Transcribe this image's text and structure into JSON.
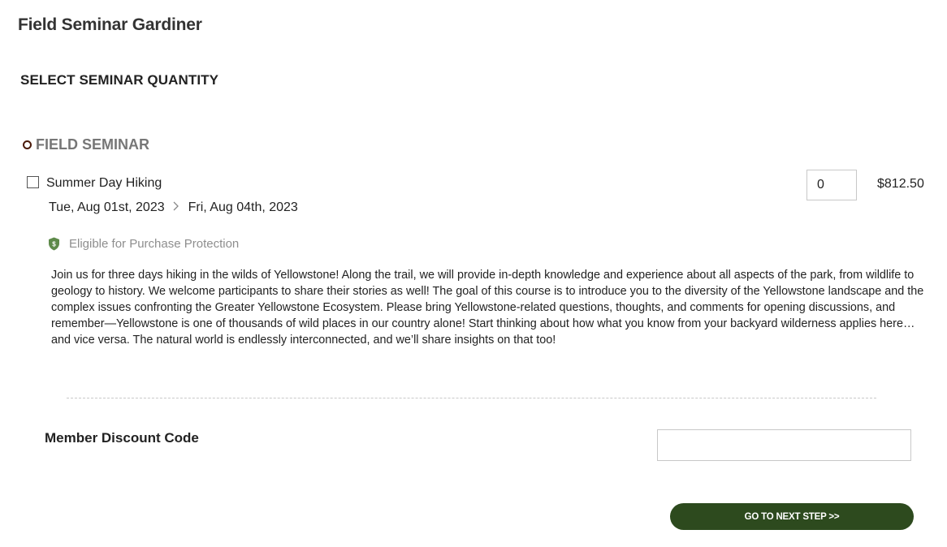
{
  "header": {
    "title": "Field Seminar Gardiner",
    "section_heading": "SELECT SEMINAR QUANTITY"
  },
  "category": {
    "label": "FIELD SEMINAR",
    "bullet_color": "#4a1a0a"
  },
  "item": {
    "name": "Summer Day Hiking",
    "checked": false,
    "start_date": "Tue, Aug 01st, 2023",
    "end_date": "Fri, Aug 04th, 2023",
    "quantity": "0",
    "price": "$812.50",
    "protection_label": "Eligible for Purchase Protection",
    "protection_icon": "shield-dollar-icon",
    "description": "Join us for three days hiking in the wilds of Yellowstone! Along the trail, we will provide in-depth knowledge and experience about all aspects of the park, from wildlife to geology to history. We welcome participants to share their stories as well! The goal of this course is to introduce you to the diversity of the Yellowstone landscape and the complex issues confronting the Greater Yellowstone Ecosystem. Please bring Yellowstone-related questions, thoughts, and comments for opening discussions, and remember—Yellowstone is one of thousands of wild places in our country alone! Start thinking about how what you know from your backyard wilderness applies here…and vice versa. The natural world is endlessly interconnected, and we’ll share insights on that too!"
  },
  "discount": {
    "label": "Member Discount Code",
    "value": "",
    "placeholder": ""
  },
  "actions": {
    "next_label": "GO TO NEXT STEP >>"
  },
  "colors": {
    "button_bg": "#2d4a1e",
    "shield": "#5e8a4a",
    "muted_text": "#8e8e8e"
  }
}
